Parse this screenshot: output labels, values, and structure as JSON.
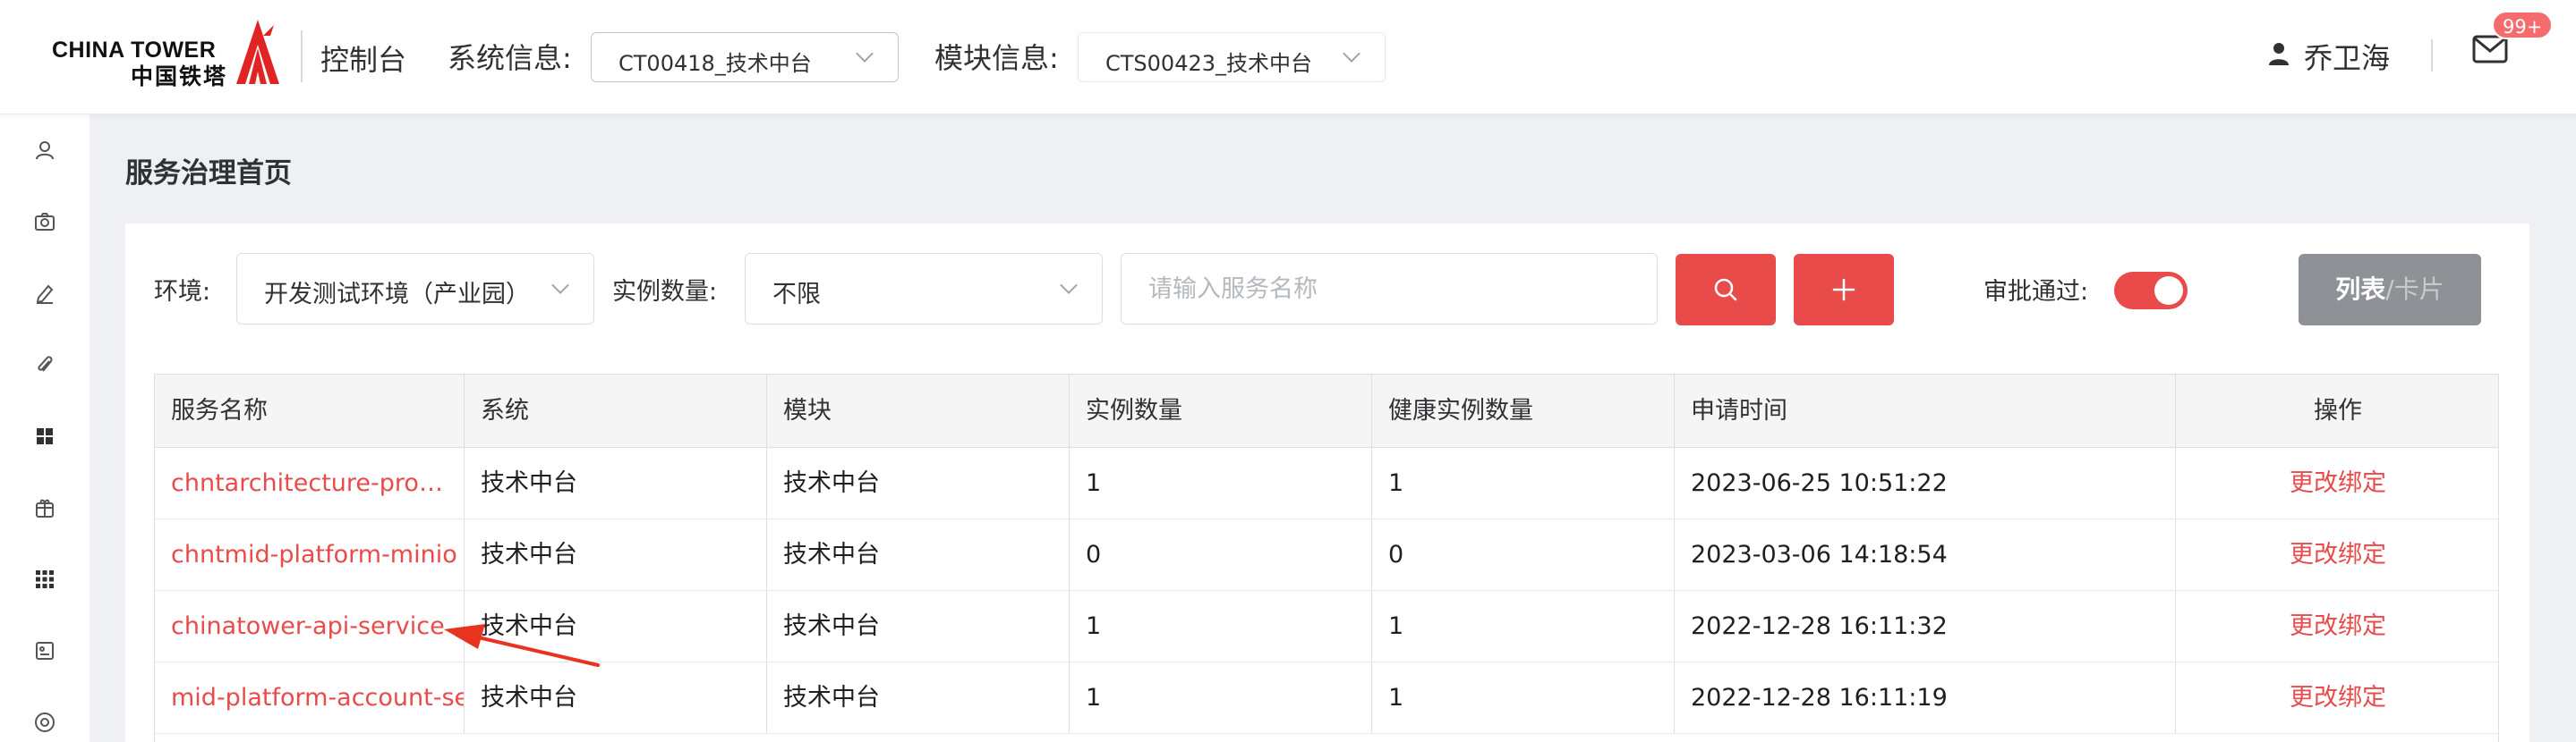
{
  "header": {
    "logo_en": "CHINA TOWER",
    "logo_cn": "中国铁塔",
    "console_label": "控制台",
    "system_label": "系统信息:",
    "system_value": "CT00418_技术中台",
    "module_label": "模块信息:",
    "module_value": "CTS00423_技术中台",
    "user_name": "乔卫海",
    "mail_badge": "99+"
  },
  "sidebar": {
    "icons": [
      "user-icon",
      "camera-icon",
      "edit-icon",
      "attachment-icon",
      "grid-icon",
      "package-icon",
      "apps-icon",
      "media-icon",
      "support-icon"
    ]
  },
  "page": {
    "title": "服务治理首页"
  },
  "filters": {
    "env_label": "环境:",
    "env_value": "开发测试环境（产业园）",
    "count_label": "实例数量:",
    "count_value": "不限",
    "search_placeholder": "请输入服务名称",
    "approve_label": "审批通过:",
    "approve_on": true,
    "view_active": "列表",
    "view_sep": "/",
    "view_inactive": "卡片"
  },
  "table": {
    "columns": [
      "服务名称",
      "系统",
      "模块",
      "实例数量",
      "健康实例数量",
      "申请时间",
      "操作"
    ],
    "rows": [
      {
        "name": "chntarchitecture-property-service",
        "system": "技术中台",
        "module": "技术中台",
        "instances": "1",
        "healthy": "1",
        "time": "2023-06-25 10:51:22",
        "action": "更改绑定"
      },
      {
        "name": "chntmid-platform-minio",
        "system": "技术中台",
        "module": "技术中台",
        "instances": "0",
        "healthy": "0",
        "time": "2023-03-06 14:18:54",
        "action": "更改绑定"
      },
      {
        "name": "chinatower-api-service",
        "system": "技术中台",
        "module": "技术中台",
        "instances": "1",
        "healthy": "1",
        "time": "2022-12-28 16:11:32",
        "action": "更改绑定"
      },
      {
        "name": "mid-platform-account-service",
        "system": "技术中台",
        "module": "技术中台",
        "instances": "1",
        "healthy": "1",
        "time": "2022-12-28 16:11:19",
        "action": "更改绑定"
      }
    ]
  },
  "colors": {
    "accent": "#e94a4a",
    "view_button": "#8e9196",
    "background": "#eef0f4"
  }
}
